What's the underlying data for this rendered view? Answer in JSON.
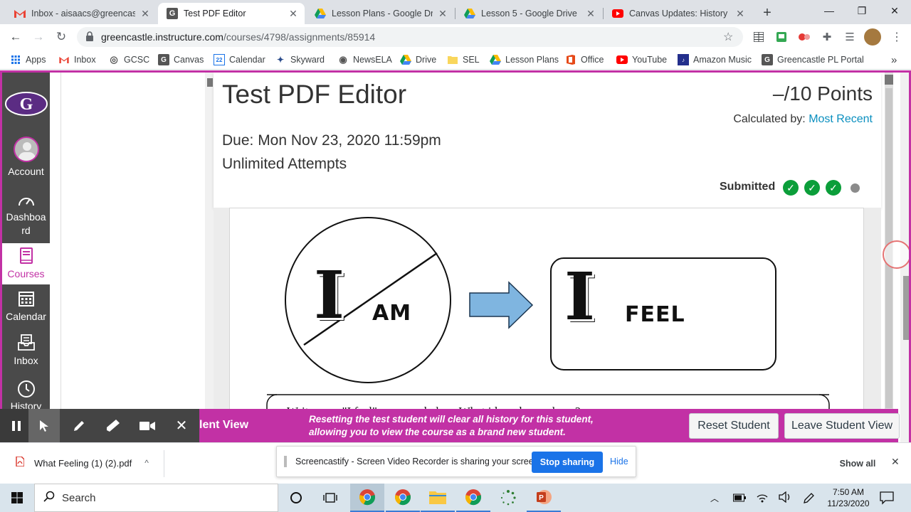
{
  "browser": {
    "tabs": [
      {
        "title": "Inbox - aisaacs@greencastle",
        "icon": "gmail-icon",
        "active": false
      },
      {
        "title": "Test PDF Editor",
        "icon": "canvas-icon",
        "active": true
      },
      {
        "title": "Lesson Plans - Google Drive",
        "icon": "google-drive-icon",
        "active": false
      },
      {
        "title": "Lesson 5 - Google Drive",
        "icon": "google-drive-icon",
        "active": false
      },
      {
        "title": "Canvas Updates: History an",
        "icon": "youtube-icon",
        "active": false
      }
    ],
    "new_tab": "+",
    "url_host": "greencastle.instructure.com",
    "url_path": "/courses/4798/assignments/85914",
    "bookmarks": [
      {
        "label": "Apps",
        "icon": "apps-icon"
      },
      {
        "label": "Inbox",
        "icon": "gmail-icon"
      },
      {
        "label": "GCSC",
        "icon": "globe-icon"
      },
      {
        "label": "Canvas",
        "icon": "canvas-icon"
      },
      {
        "label": "Calendar",
        "icon": "calendar-icon"
      },
      {
        "label": "Skyward",
        "icon": "skyward-icon"
      },
      {
        "label": "NewsELA",
        "icon": "globe-icon"
      },
      {
        "label": "Drive",
        "icon": "google-drive-icon"
      },
      {
        "label": "SEL",
        "icon": "folder-icon"
      },
      {
        "label": "Lesson Plans",
        "icon": "google-drive-icon"
      },
      {
        "label": "Office",
        "icon": "office-icon"
      },
      {
        "label": "YouTube",
        "icon": "youtube-icon"
      },
      {
        "label": "Amazon Music",
        "icon": "amazon-music-icon"
      },
      {
        "label": "Greencastle PL Portal",
        "icon": "canvas-icon"
      }
    ],
    "more_bookmarks": "»"
  },
  "global_nav": {
    "items": [
      {
        "label": "Account",
        "icon": "avatar-icon"
      },
      {
        "label": "Dashboa rd",
        "icon": "dashboard-icon"
      },
      {
        "label": "Courses",
        "icon": "courses-icon"
      },
      {
        "label": "Calendar",
        "icon": "calendar-icon"
      },
      {
        "label": "Inbox",
        "icon": "inbox-icon"
      },
      {
        "label": "History",
        "icon": "history-icon"
      }
    ]
  },
  "assignment": {
    "title": "Test PDF Editor",
    "points": "–/10 Points",
    "calculated_label": "Calculated by:",
    "calculated_value": "Most Recent",
    "due": "Due: Mon Nov 23, 2020 11:59pm",
    "attempts": "Unlimited Attempts",
    "status": "Submitted",
    "steps_done": 3,
    "steps_total": 4,
    "accent": "#0b9e3a",
    "link_color": "#0a8fbf"
  },
  "pdf": {
    "word_i": "I",
    "word_am": "AM",
    "word_feel": "FEEL",
    "prompt_line": "Write your \"I feel\" message below. What ideas do you have?"
  },
  "student_view": {
    "label": "lent View",
    "notice": "Resetting the test student will clear all history for this student, allowing you to view the course as a brand new student.",
    "reset_button": "Reset Student",
    "leave_button": "Leave Student View",
    "bar_color": "#c231a5"
  },
  "downloads": {
    "file": "What Feeling (1) (2).pdf",
    "show_all": "Show all"
  },
  "screencastify": {
    "message": "Screencastify - Screen Video Recorder is sharing your screen.",
    "stop": "Stop sharing",
    "hide": "Hide"
  },
  "taskbar": {
    "search": "Search",
    "time": "7:50 AM",
    "date": "11/23/2020"
  }
}
